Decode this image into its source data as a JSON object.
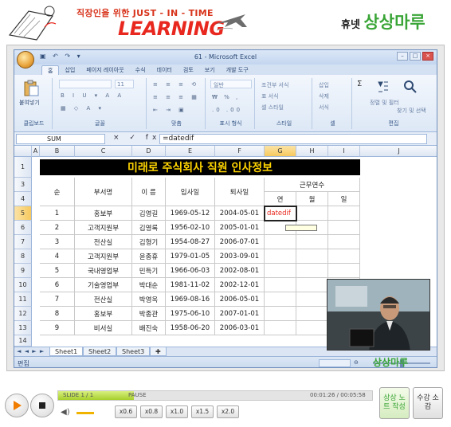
{
  "banner": {
    "tagline": "직장인을 위한 JUST - IN - TIME",
    "learning": "LEARNING",
    "brand_prefix": "휴넷",
    "brand_main": "상상마루"
  },
  "excel": {
    "title": "61 - Microsoft Excel",
    "tabs": [
      "홈",
      "삽입",
      "페이지 레이아웃",
      "수식",
      "데이터",
      "검토",
      "보기",
      "개발 도구"
    ],
    "ribbon_groups": [
      "클립보드",
      "글꼴",
      "맞춤",
      "표시 형식",
      "스타일",
      "셀",
      "편집"
    ],
    "paste_label": "붙여넣기",
    "font_size": "11",
    "number_format": "일반",
    "styles": [
      "조건부 서식",
      "표 서식",
      "셀 스타일"
    ],
    "cells_group": [
      "삽입",
      "삭제",
      "서식"
    ],
    "edit_group": [
      "정렬 및 필터",
      "찾기 및 선택"
    ],
    "name_box": "SUM",
    "formula": "=datedif",
    "columns": [
      "A",
      "B",
      "C",
      "D",
      "E",
      "F",
      "G",
      "H",
      "I",
      "J"
    ],
    "sheet_title": "미래로 주식회사 직원 인사정보",
    "headers": {
      "no": "순",
      "dept": "부서명",
      "name": "이  름",
      "join": "입사일",
      "leave": "퇴사일",
      "tenure": "근무연수",
      "year": "연",
      "month": "월",
      "day": "일"
    },
    "rows": [
      {
        "r": "5",
        "no": "1",
        "dept": "홍보부",
        "name": "김영길",
        "join": "1969-05-12",
        "leave": "2004-05-01"
      },
      {
        "r": "6",
        "no": "2",
        "dept": "고객지원부",
        "name": "김영록",
        "join": "1956-02-10",
        "leave": "2005-01-01"
      },
      {
        "r": "7",
        "no": "3",
        "dept": "전산실",
        "name": "김형기",
        "join": "1954-08-27",
        "leave": "2006-07-01"
      },
      {
        "r": "8",
        "no": "4",
        "dept": "고객지원부",
        "name": "윤종휴",
        "join": "1979-01-05",
        "leave": "2003-09-01"
      },
      {
        "r": "9",
        "no": "5",
        "dept": "국내영업부",
        "name": "민득기",
        "join": "1966-06-03",
        "leave": "2002-08-01"
      },
      {
        "r": "10",
        "no": "6",
        "dept": "기술영업부",
        "name": "박대순",
        "join": "1981-11-02",
        "leave": "2002-12-01"
      },
      {
        "r": "11",
        "no": "7",
        "dept": "전산실",
        "name": "박영옥",
        "join": "1969-08-16",
        "leave": "2006-05-01"
      },
      {
        "r": "12",
        "no": "8",
        "dept": "홍보부",
        "name": "박종관",
        "join": "1975-06-10",
        "leave": "2007-01-01"
      },
      {
        "r": "13",
        "no": "9",
        "dept": "비서실",
        "name": "배진숙",
        "join": "1958-06-20",
        "leave": "2006-03-01"
      }
    ],
    "active_cell_text": "datedif",
    "sheets": [
      "Sheet1",
      "Sheet2",
      "Sheet3"
    ],
    "status": "편집"
  },
  "player": {
    "slide_text": "SLIDE  1 /  1",
    "pause_text": "PAUSE",
    "time_text": "00:01:26 / 00:05:58",
    "progress": 0.24,
    "speeds": [
      "x0.6",
      "x0.8",
      "x1.0",
      "x1.5",
      "x2.0"
    ],
    "note_button": "상상 노트 작성",
    "end_button": "수강 소감"
  },
  "colors": {
    "accent_red": "#e8281f",
    "brand_green": "#3aa537",
    "title_yellow": "#ffd400",
    "progress_green": "#a6cf2c"
  }
}
